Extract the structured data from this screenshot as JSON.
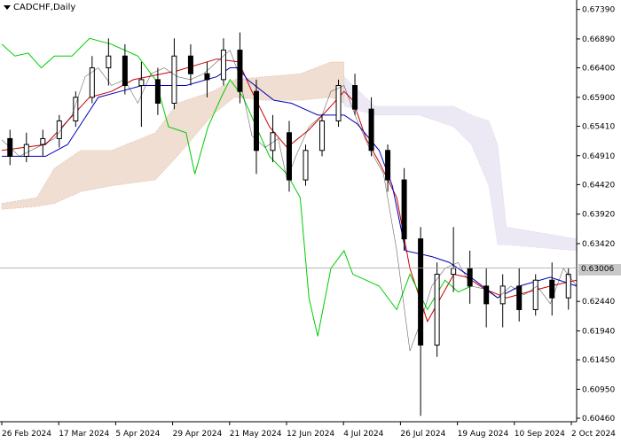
{
  "chart_data": {
    "type": "candlestick",
    "title": "CADCHF,Daily",
    "symbol": "CADCHF",
    "timeframe": "Daily",
    "current_price": "0.63006",
    "ylim": [
      0.604,
      0.6755
    ],
    "y_ticks": [
      "0.67390",
      "0.66890",
      "0.66400",
      "0.65900",
      "0.65410",
      "0.64910",
      "0.64420",
      "0.63920",
      "0.63420",
      "0.62440",
      "0.61940",
      "0.61450",
      "0.60950",
      "0.60460"
    ],
    "x_ticks": [
      "26 Feb 2024",
      "17 Mar 2024",
      "5 Apr 2024",
      "29 Apr 2024",
      "21 May 2024",
      "12 Jun 2024",
      "4 Jul 2024",
      "26 Jul 2024",
      "19 Aug 2024",
      "10 Sep 2024",
      "2 Oct 2024"
    ],
    "grid": false,
    "indicators": [
      "Ichimoku Kinko Hyo"
    ],
    "close_path": [
      [
        0,
        0.6518
      ],
      [
        8,
        0.649
      ],
      [
        16,
        0.6505
      ],
      [
        24,
        0.652
      ],
      [
        32,
        0.656
      ],
      [
        38,
        0.6625
      ],
      [
        44,
        0.664
      ],
      [
        50,
        0.661
      ],
      [
        56,
        0.662
      ],
      [
        62,
        0.658
      ],
      [
        68,
        0.663
      ],
      [
        74,
        0.664
      ],
      [
        80,
        0.6625
      ],
      [
        86,
        0.662
      ],
      [
        92,
        0.663
      ],
      [
        98,
        0.665
      ],
      [
        104,
        0.667
      ],
      [
        108,
        0.663
      ],
      [
        114,
        0.6525
      ],
      [
        120,
        0.6505
      ],
      [
        126,
        0.652
      ],
      [
        130,
        0.645
      ],
      [
        134,
        0.649
      ],
      [
        140,
        0.654
      ],
      [
        146,
        0.656
      ],
      [
        150,
        0.66
      ],
      [
        156,
        0.661
      ],
      [
        162,
        0.655
      ],
      [
        168,
        0.65
      ],
      [
        174,
        0.646
      ],
      [
        180,
        0.633
      ],
      [
        186,
        0.616
      ],
      [
        190,
        0.62
      ],
      [
        196,
        0.627
      ],
      [
        202,
        0.63
      ],
      [
        208,
        0.631
      ],
      [
        214,
        0.627
      ],
      [
        220,
        0.6265
      ],
      [
        226,
        0.625
      ],
      [
        232,
        0.627
      ],
      [
        238,
        0.6255
      ],
      [
        244,
        0.627
      ],
      [
        250,
        0.624
      ],
      [
        256,
        0.63
      ],
      [
        262,
        0.627
      ]
    ],
    "candles_ohlc": [
      [
        0.652,
        0.6535,
        0.6475,
        0.649
      ],
      [
        0.649,
        0.653,
        0.648,
        0.651
      ],
      [
        0.651,
        0.6535,
        0.649,
        0.652
      ],
      [
        0.652,
        0.656,
        0.6505,
        0.655
      ],
      [
        0.655,
        0.66,
        0.654,
        0.659
      ],
      [
        0.659,
        0.666,
        0.658,
        0.664
      ],
      [
        0.664,
        0.669,
        0.661,
        0.666
      ],
      [
        0.666,
        0.668,
        0.6595,
        0.661
      ],
      [
        0.661,
        0.665,
        0.654,
        0.662
      ],
      [
        0.662,
        0.664,
        0.656,
        0.658
      ],
      [
        0.658,
        0.669,
        0.657,
        0.666
      ],
      [
        0.666,
        0.668,
        0.661,
        0.663
      ],
      [
        0.663,
        0.665,
        0.659,
        0.662
      ],
      [
        0.662,
        0.669,
        0.661,
        0.667
      ],
      [
        0.667,
        0.67,
        0.658,
        0.66
      ],
      [
        0.66,
        0.662,
        0.646,
        0.65
      ],
      [
        0.65,
        0.656,
        0.648,
        0.653
      ],
      [
        0.653,
        0.655,
        0.643,
        0.645
      ],
      [
        0.645,
        0.651,
        0.644,
        0.65
      ],
      [
        0.65,
        0.656,
        0.649,
        0.655
      ],
      [
        0.655,
        0.662,
        0.654,
        0.661
      ],
      [
        0.661,
        0.663,
        0.656,
        0.657
      ],
      [
        0.657,
        0.659,
        0.649,
        0.65
      ],
      [
        0.65,
        0.651,
        0.643,
        0.645
      ],
      [
        0.645,
        0.647,
        0.633,
        0.635
      ],
      [
        0.635,
        0.637,
        0.605,
        0.617
      ],
      [
        0.617,
        0.631,
        0.615,
        0.629
      ],
      [
        0.629,
        0.637,
        0.626,
        0.63
      ],
      [
        0.63,
        0.633,
        0.624,
        0.627
      ],
      [
        0.627,
        0.63,
        0.62,
        0.624
      ],
      [
        0.624,
        0.629,
        0.62,
        0.627
      ],
      [
        0.627,
        0.63,
        0.621,
        0.623
      ],
      [
        0.623,
        0.629,
        0.622,
        0.628
      ],
      [
        0.628,
        0.631,
        0.622,
        0.625
      ],
      [
        0.625,
        0.63,
        0.623,
        0.629
      ]
    ],
    "series": [
      {
        "color": "#cc0000",
        "points": [
          [
            0,
            0.65
          ],
          [
            20,
            0.651
          ],
          [
            40,
            0.659
          ],
          [
            50,
            0.66
          ],
          [
            60,
            0.662
          ],
          [
            80,
            0.6635
          ],
          [
            98,
            0.6655
          ],
          [
            108,
            0.665
          ],
          [
            114,
            0.66
          ],
          [
            122,
            0.654
          ],
          [
            130,
            0.6505
          ],
          [
            140,
            0.6535
          ],
          [
            150,
            0.6575
          ],
          [
            156,
            0.66
          ],
          [
            160,
            0.6585
          ],
          [
            166,
            0.652
          ],
          [
            172,
            0.648
          ],
          [
            180,
            0.642
          ],
          [
            186,
            0.63
          ],
          [
            194,
            0.621
          ],
          [
            200,
            0.625
          ],
          [
            206,
            0.629
          ],
          [
            212,
            0.6285
          ],
          [
            220,
            0.6265
          ],
          [
            230,
            0.625
          ],
          [
            240,
            0.626
          ],
          [
            250,
            0.627
          ],
          [
            262,
            0.628
          ]
        ]
      },
      {
        "color": "#0000bb",
        "points": [
          [
            0,
            0.649
          ],
          [
            20,
            0.649
          ],
          [
            30,
            0.651
          ],
          [
            44,
            0.659
          ],
          [
            54,
            0.66
          ],
          [
            64,
            0.661
          ],
          [
            84,
            0.661
          ],
          [
            98,
            0.6625
          ],
          [
            104,
            0.664
          ],
          [
            108,
            0.664
          ],
          [
            112,
            0.662
          ],
          [
            124,
            0.6585
          ],
          [
            132,
            0.658
          ],
          [
            144,
            0.656
          ],
          [
            156,
            0.656
          ],
          [
            162,
            0.6545
          ],
          [
            172,
            0.65
          ],
          [
            178,
            0.644
          ],
          [
            184,
            0.633
          ],
          [
            196,
            0.632
          ],
          [
            204,
            0.631
          ],
          [
            212,
            0.629
          ],
          [
            226,
            0.625
          ],
          [
            236,
            0.627
          ],
          [
            250,
            0.6285
          ],
          [
            262,
            0.627
          ]
        ]
      },
      {
        "color": "#00cc00",
        "points": [
          [
            0,
            0.668
          ],
          [
            6,
            0.666
          ],
          [
            12,
            0.6665
          ],
          [
            18,
            0.664
          ],
          [
            24,
            0.666
          ],
          [
            32,
            0.666
          ],
          [
            40,
            0.669
          ],
          [
            50,
            0.668
          ],
          [
            62,
            0.666
          ],
          [
            70,
            0.662
          ],
          [
            76,
            0.654
          ],
          [
            84,
            0.653
          ],
          [
            88,
            0.646
          ],
          [
            94,
            0.654
          ],
          [
            100,
            0.659
          ],
          [
            104,
            0.662
          ],
          [
            110,
            0.659
          ],
          [
            116,
            0.654
          ],
          [
            122,
            0.649
          ],
          [
            130,
            0.646
          ],
          [
            136,
            0.642
          ],
          [
            140,
            0.625
          ],
          [
            144,
            0.6185
          ],
          [
            150,
            0.63
          ],
          [
            156,
            0.633
          ],
          [
            160,
            0.629
          ],
          [
            166,
            0.628
          ],
          [
            172,
            0.627
          ],
          [
            180,
            0.623
          ],
          [
            186,
            0.629
          ],
          [
            194,
            0.623
          ],
          [
            202,
            0.628
          ],
          [
            208,
            0.626
          ],
          [
            214,
            0.627
          ]
        ]
      }
    ],
    "cloud": [
      {
        "color": "#d2a07a",
        "points": [
          [
            0,
            0.64,
            0.641
          ],
          [
            16,
            0.6405,
            0.642
          ],
          [
            24,
            0.641,
            0.647
          ],
          [
            36,
            0.643,
            0.65
          ],
          [
            50,
            0.644,
            0.65
          ],
          [
            70,
            0.645,
            0.653
          ],
          [
            80,
            0.649,
            0.658
          ],
          [
            96,
            0.656,
            0.66
          ],
          [
            106,
            0.659,
            0.662
          ],
          [
            120,
            0.6585,
            0.6625
          ],
          [
            136,
            0.6585,
            0.663
          ],
          [
            150,
            0.659,
            0.665
          ],
          [
            156,
            0.658,
            0.665
          ]
        ]
      },
      {
        "color": "#c8bfe0",
        "points": [
          [
            156,
            0.6575,
            0.6625
          ],
          [
            170,
            0.656,
            0.6575
          ],
          [
            190,
            0.656,
            0.6575
          ],
          [
            206,
            0.654,
            0.6575
          ],
          [
            214,
            0.651,
            0.656
          ],
          [
            222,
            0.644,
            0.655
          ],
          [
            226,
            0.634,
            0.651
          ],
          [
            230,
            0.634,
            0.637
          ],
          [
            262,
            0.633,
            0.635
          ]
        ]
      }
    ]
  }
}
